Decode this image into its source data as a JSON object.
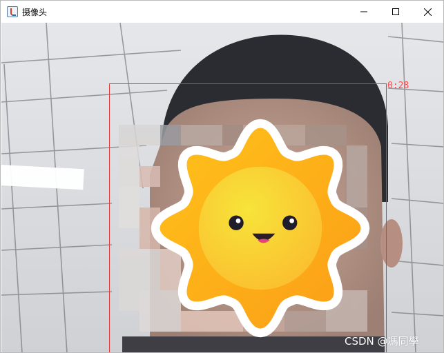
{
  "window": {
    "title": "摄像头",
    "icon": "java-cup-icon"
  },
  "controls": {
    "minimize_icon": "minimize-icon",
    "maximize_icon": "maximize-icon",
    "close_icon": "close-icon"
  },
  "camera": {
    "timer_text": "0:28",
    "overlay_icon": "smiling-sun-icon",
    "face_box_color": "#e23a3a"
  },
  "watermark": {
    "text": "CSDN @馮同學"
  },
  "colors": {
    "sun_outer": "#fdb022",
    "sun_inner": "#fbd53a",
    "timer_red": "#ff4b4b"
  }
}
